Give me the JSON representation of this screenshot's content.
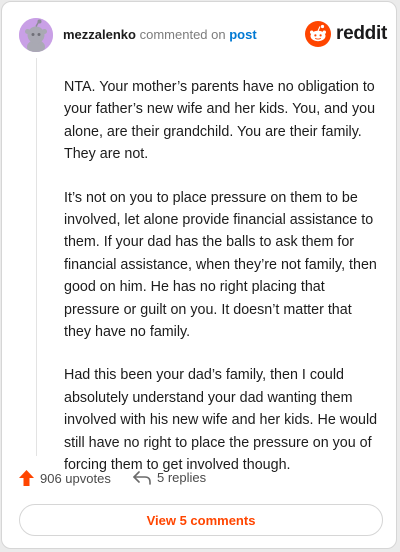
{
  "header": {
    "username": "mezzalenko",
    "action_text": "commented on",
    "post_link": "post",
    "brand": "reddit"
  },
  "comment": {
    "paragraphs": [
      "NTA. Your mother’s parents have no obligation to your father’s new wife and her kids. You, and you alone, are their grandchild. You are their family. They are not.",
      "It’s not on you to place pressure on them to be involved, let alone provide financial assistance to them. If your dad has the balls to ask them for financial assistance, when they’re not family, then good on him. He has no right placing that pressure or guilt on you. It doesn’t matter that they have no family.",
      "Had this been your dad’s family, then I could absolutely understand your dad wanting them involved with his new wife and her kids. He would still have no right to place the pressure on you of forcing them to get involved though."
    ]
  },
  "footer": {
    "upvotes": "906 upvotes",
    "replies": "5 replies",
    "view_button": "View 5 comments"
  },
  "icons": {
    "avatar": "snoo-avatar-icon",
    "brand": "reddit-logo-icon",
    "upvote": "upvote-arrow-icon",
    "reply": "reply-arrow-icon"
  },
  "colors": {
    "accent": "#ff4500",
    "link": "#0079d3",
    "avatar_bg": "#c9a0e6"
  }
}
